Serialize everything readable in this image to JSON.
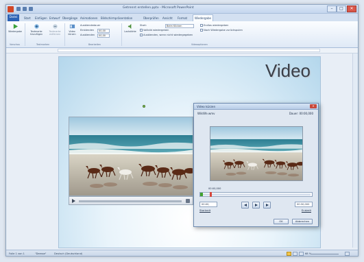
{
  "window": {
    "title": "Getrennt erstellen.pptx - Microsoft PowerPoint",
    "min": "–",
    "max": "□",
    "close": "✕"
  },
  "tabs": {
    "file": "Datei",
    "items": [
      "Start",
      "Einfügen",
      "Entwurf",
      "Übergänge",
      "Animationen",
      "Bildschirmpräsentation",
      "Überprüfen",
      "Ansicht",
      "Format",
      "Wiedergabe"
    ]
  },
  "ribbon": {
    "play": "Wiedergabe",
    "add_bookmark": "Textmarke hinzufügen",
    "remove_bookmark": "Textmarke entfernen",
    "trim_video": "Video kürzen",
    "fade_duration": "Ausblendedauer",
    "fade_in": "Einblenden",
    "fade_in_value": "00,00",
    "fade_out": "Ausblenden",
    "fade_out_value": "00,00",
    "volume": "Lautstärke",
    "start_label": "Start:",
    "start_value": "Beim Klicken",
    "fullscreen": "Vollbild wiedergeben",
    "hide_when_not_playing": "Ausblenden, wenn nicht wiedergegeben",
    "loop": "Endlos wiedergeben",
    "rewind": "Nach Wiedergabe zurückspulen",
    "group_preview": "Vorschau",
    "group_bookmarks": "Textmarken",
    "group_edit": "Bearbeiten",
    "group_options": "Videooptionen"
  },
  "slide": {
    "title": "Video"
  },
  "dialog": {
    "title": "Video kürzen",
    "filename": "Wildlife.wmv",
    "duration": "Dauer: 00:00,000",
    "timecode": "00:00,000",
    "start_time": "00:00,",
    "start_label": "Startzeit",
    "end_time": "00:30,000",
    "end_label": "Endzeit",
    "ok": "OK",
    "cancel": "Abbrechen"
  },
  "status": {
    "slide_info": "Folie 1 von 1",
    "theme": "\"Deesse\"",
    "language": "Deutsch (Deutschland)",
    "zoom": "68 %"
  },
  "colors": {
    "accent": "#2b62b5",
    "play_green": "#43a32f",
    "trim_red": "#d5463b"
  }
}
